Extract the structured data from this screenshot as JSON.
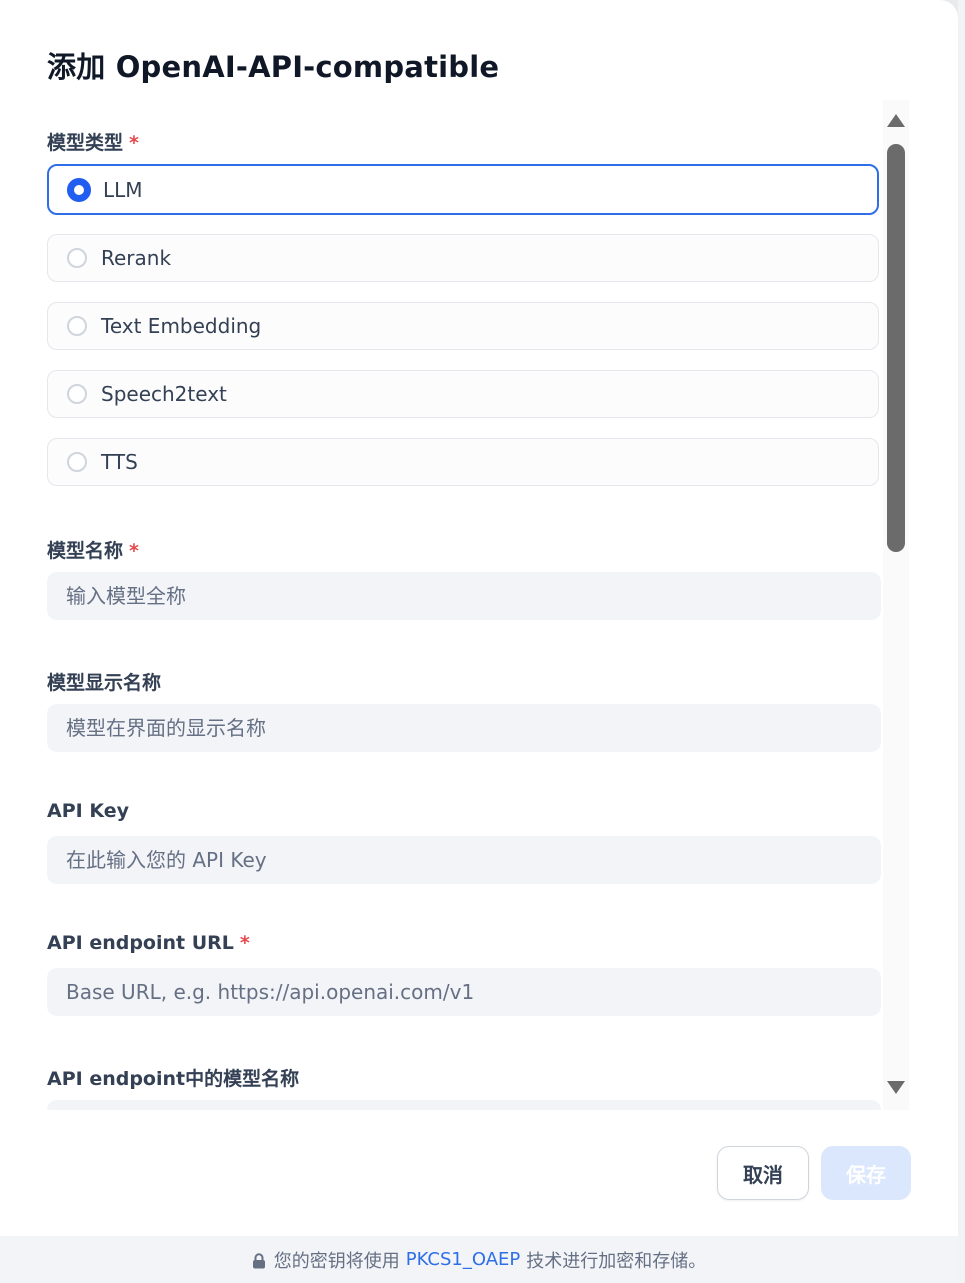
{
  "dialog": {
    "title": "添加 OpenAI-API-compatible"
  },
  "model_type": {
    "label": "模型类型",
    "required_mark": "*",
    "options": [
      {
        "label": "LLM",
        "selected": true
      },
      {
        "label": "Rerank",
        "selected": false
      },
      {
        "label": "Text Embedding",
        "selected": false
      },
      {
        "label": "Speech2text",
        "selected": false
      },
      {
        "label": "TTS",
        "selected": false
      }
    ]
  },
  "model_name": {
    "label": "模型名称",
    "required_mark": "*",
    "placeholder": "输入模型全称",
    "value": ""
  },
  "display_name": {
    "label": "模型显示名称",
    "placeholder": "模型在界面的显示名称",
    "value": ""
  },
  "api_key": {
    "label": "API Key",
    "placeholder": "在此输入您的 API Key",
    "value": ""
  },
  "endpoint_url": {
    "label": "API endpoint URL",
    "required_mark": "*",
    "placeholder": "Base URL, e.g. https://api.openai.com/v1",
    "value": ""
  },
  "endpoint_model_name": {
    "label": "API endpoint中的模型名称",
    "value": ""
  },
  "actions": {
    "cancel_label": "取消",
    "save_label": "保存"
  },
  "footer": {
    "prefix": "您的密钥将使用",
    "link": "PKCS1_OAEP",
    "suffix": "技术进行加密和存储。",
    "icon": "lock-icon"
  },
  "colors": {
    "accent": "#1f5ef0",
    "save_disabled_bg": "#dbe7fd",
    "required": "#e5484d"
  }
}
